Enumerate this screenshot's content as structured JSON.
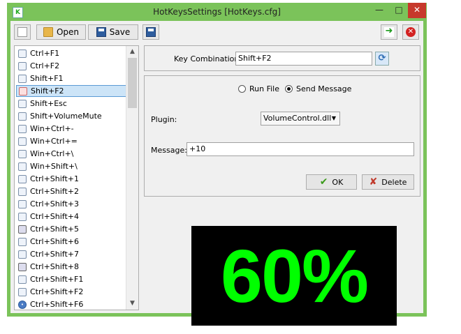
{
  "window": {
    "title": "HotKeysSettings [HotKeys.cfg]",
    "app_icon_letter": "K"
  },
  "window_controls": {
    "minimize": "—",
    "maximize": "□",
    "close": "✕"
  },
  "toolbar": {
    "open_label": "Open",
    "save_label": "Save"
  },
  "hotkeys": [
    {
      "label": "Ctrl+F1",
      "icon": "send-message-icon"
    },
    {
      "label": "Ctrl+F2",
      "icon": "send-message-icon"
    },
    {
      "label": "Shift+F1",
      "icon": "send-message-icon"
    },
    {
      "label": "Shift+F2",
      "icon": "send-message-icon",
      "selected": true
    },
    {
      "label": "Shift+Esc",
      "icon": "send-message-icon"
    },
    {
      "label": "Shift+VolumeMute",
      "icon": "send-message-icon"
    },
    {
      "label": "Win+Ctrl+-",
      "icon": "send-message-icon"
    },
    {
      "label": "Win+Ctrl+=",
      "icon": "send-message-icon"
    },
    {
      "label": "Win+Ctrl+\\",
      "icon": "send-message-icon"
    },
    {
      "label": "Win+Shift+\\",
      "icon": "send-message-icon"
    },
    {
      "label": "Ctrl+Shift+1",
      "icon": "send-message-icon"
    },
    {
      "label": "Ctrl+Shift+2",
      "icon": "send-message-icon"
    },
    {
      "label": "Ctrl+Shift+3",
      "icon": "send-message-icon"
    },
    {
      "label": "Ctrl+Shift+4",
      "icon": "send-message-icon"
    },
    {
      "label": "Ctrl+Shift+5",
      "icon": "screen-icon"
    },
    {
      "label": "Ctrl+Shift+6",
      "icon": "send-message-icon"
    },
    {
      "label": "Ctrl+Shift+7",
      "icon": "send-message-icon"
    },
    {
      "label": "Ctrl+Shift+8",
      "icon": "screen-icon"
    },
    {
      "label": "Ctrl+Shift+F1",
      "icon": "send-message-icon"
    },
    {
      "label": "Ctrl+Shift+F2",
      "icon": "send-message-icon"
    },
    {
      "label": "Ctrl+Shift+F6",
      "icon": "lock-icon"
    }
  ],
  "key_combination": {
    "label": "Key Combination:",
    "value": "Shift+F2"
  },
  "action": {
    "run_file_label": "Run File",
    "send_message_label": "Send Message",
    "selected": "Send Message"
  },
  "plugin": {
    "label": "Plugin:",
    "value": "VolumeControl.dll"
  },
  "message": {
    "label": "Message:",
    "value": "+10"
  },
  "buttons": {
    "ok_label": "OK",
    "delete_label": "Delete"
  },
  "overlay": {
    "text": "60%",
    "color": "#00ff00"
  },
  "colors": {
    "frame": "#7bc35a",
    "close": "#c7392b",
    "selection": "#cce4f7"
  }
}
